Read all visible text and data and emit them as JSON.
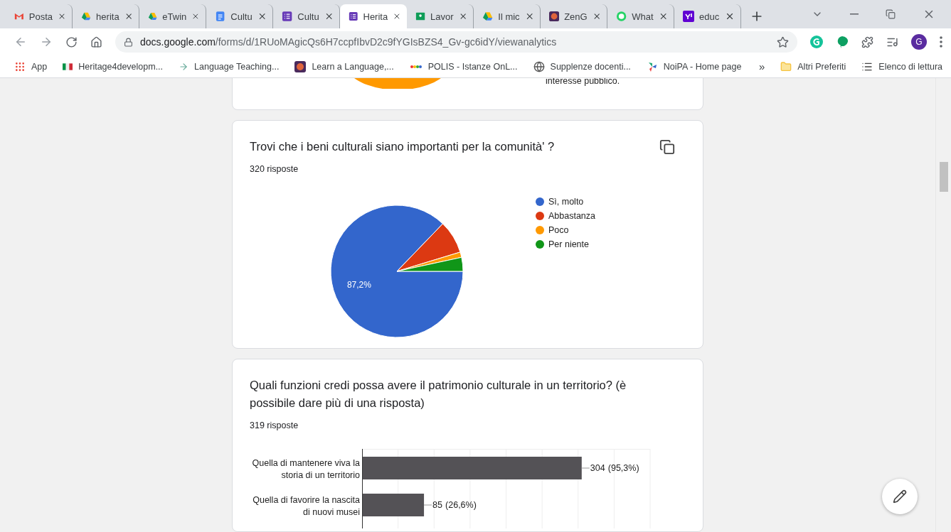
{
  "tabs": [
    {
      "title": "Posta",
      "selected": false
    },
    {
      "title": "herita",
      "selected": false
    },
    {
      "title": "eTwin",
      "selected": false
    },
    {
      "title": "Cultu",
      "selected": false
    },
    {
      "title": "Cultu",
      "selected": false
    },
    {
      "title": "Herita",
      "selected": true
    },
    {
      "title": "Lavor",
      "selected": false
    },
    {
      "title": "Il mic",
      "selected": false
    },
    {
      "title": "ZenG",
      "selected": false
    },
    {
      "title": "What",
      "selected": false
    },
    {
      "title": "educ",
      "selected": false
    }
  ],
  "address": {
    "url_host": "docs.google.com",
    "url_path": "/forms/d/1RUoMAgicQs6H7ccpfIbvD2c9fYGIsBZS4_Gv-gc6idY/viewanalytics"
  },
  "profile_initial": "G",
  "bookmarks": [
    "App",
    "Heritage4developm...",
    "Language Teaching...",
    "Learn a Language,...",
    "POLIS - Istanze OnL...",
    "Supplenze docenti...",
    "NoiPA - Home page"
  ],
  "bookmarks_more": "»",
  "bookmarks_right": [
    "Altri Preferiti",
    "Elenco di lettura"
  ],
  "previous_card": {
    "legend_text": "interesse pubblico."
  },
  "questions": [
    {
      "title": "Trovi che i beni culturali siano importanti per la comunità' ?",
      "responses": "320 risposte",
      "chart_data": {
        "type": "pie",
        "categories": [
          "Sì, molto",
          "Abbastanza",
          "Poco",
          "Per niente"
        ],
        "series": [
          {
            "values": [
              87.2,
              8.1,
              1.3,
              3.4
            ]
          }
        ],
        "value_labels": [
          "87,2%",
          null,
          null,
          null
        ]
      }
    },
    {
      "title": "Quali funzioni credi possa avere il patrimonio culturale in un territorio? (è possibile dare più di una risposta)",
      "responses": "319 risposte",
      "chart_data": {
        "type": "bar",
        "orientation": "horizontal",
        "categories": [
          "Quella di mantenere viva la storia di un territorio",
          "Quella di favorire la nascita di nuovi musei"
        ],
        "series": [
          {
            "color": "#545256",
            "values": [
              304,
              85
            ]
          }
        ],
        "data_labels": true,
        "annotations": [
          {
            "text": "(95,3%)"
          },
          {
            "text": "(26,6%)"
          }
        ]
      }
    }
  ]
}
